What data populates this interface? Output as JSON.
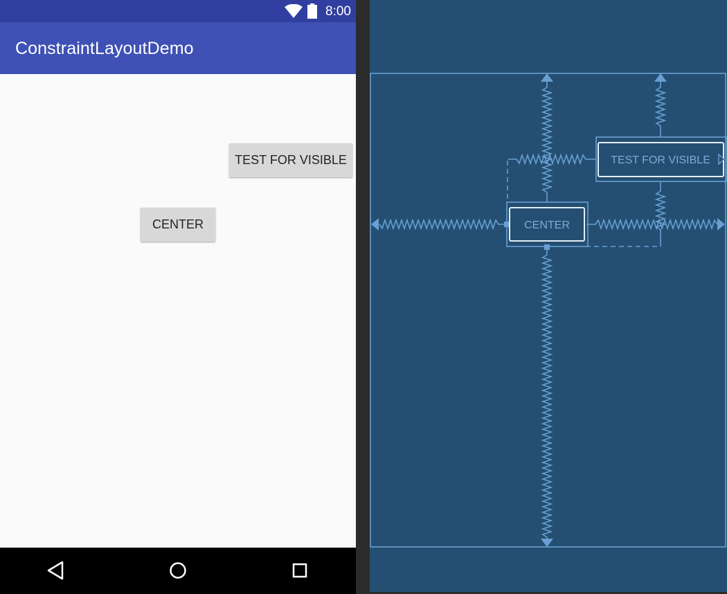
{
  "status_bar": {
    "time": "8:00",
    "icons": [
      "wifi-icon",
      "battery-icon"
    ]
  },
  "app_bar": {
    "title": "ConstraintLayoutDemo"
  },
  "content": {
    "buttons": [
      {
        "label": "TEST FOR VISIBLE"
      },
      {
        "label": "CENTER"
      }
    ]
  },
  "nav_bar": {
    "icons": [
      "back-icon",
      "home-icon",
      "recents-icon"
    ]
  },
  "blueprint": {
    "widgets": [
      {
        "label": "TEST FOR VISIBLE"
      },
      {
        "label": "CENTER"
      }
    ]
  },
  "colors": {
    "status_bar": "#303f9f",
    "app_bar": "#3f51b5",
    "blueprint_bg": "#244f72",
    "blueprint_line": "#6a9fd3",
    "button_bg": "#d8d8d8"
  }
}
